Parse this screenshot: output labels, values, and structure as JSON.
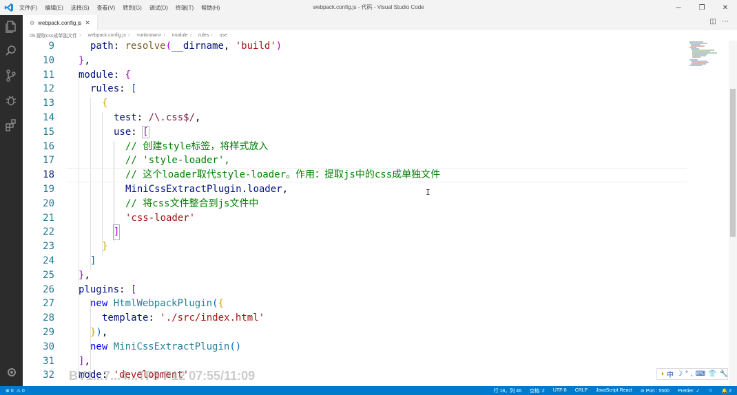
{
  "window": {
    "title": "webpack.config.js - 代码 - Visual Studio Code",
    "menus": [
      "文件(F)",
      "编辑(E)",
      "选择(S)",
      "查看(V)",
      "转到(G)",
      "调试(D)",
      "终端(T)",
      "帮助(H)"
    ],
    "controls": [
      "─",
      "❐",
      "✕"
    ]
  },
  "tabs": [
    {
      "label": "webpack.config.js",
      "icon": "config-file-icon",
      "close": "✕"
    }
  ],
  "tab_actions": [
    "◫",
    "⋯"
  ],
  "breadcrumb": [
    "09.提取css成单独文件",
    "webpack.config.js",
    "<unknown>",
    "module",
    "rules",
    "use"
  ],
  "editor": {
    "line_numbers": [
      "9",
      "10",
      "11",
      "12",
      "13",
      "14",
      "15",
      "16",
      "17",
      "18",
      "19",
      "20",
      "21",
      "22",
      "23",
      "24",
      "25",
      "26",
      "27",
      "28",
      "29",
      "30",
      "31",
      "32"
    ],
    "current_line": "18"
  },
  "code": {
    "l9": [
      "path",
      ": ",
      "resolve",
      "(",
      "__dirname",
      ", ",
      "'build'",
      ")"
    ],
    "l10": [
      "}",
      ","
    ],
    "l11": [
      "module",
      ": ",
      "{"
    ],
    "l12": [
      "rules",
      ": ",
      "["
    ],
    "l13": [
      "{"
    ],
    "l14": [
      "test",
      ": ",
      "/\\.css$/",
      ","
    ],
    "l15": [
      "use",
      ": ",
      "["
    ],
    "l16": "// 创建style标签，将样式放入",
    "l17": "// 'style-loader',",
    "l18": "// 这个loader取代style-loader。作用：提取js中的css成单独文件",
    "l19": [
      "MiniCssExtractPlugin",
      ".",
      "loader",
      ","
    ],
    "l20": "// 将css文件整合到js文件中",
    "l21": "'css-loader'",
    "l22": "]",
    "l23": "}",
    "l24": "]",
    "l25": [
      "}",
      ","
    ],
    "l26": [
      "plugins",
      ": ",
      "["
    ],
    "l27": [
      "new",
      " ",
      "HtmlWebpackPlugin",
      "(",
      "{"
    ],
    "l28": [
      "template",
      ": ",
      "'./src/index.html'"
    ],
    "l29": [
      "}",
      ")",
      ","
    ],
    "l30": [
      "new",
      " ",
      "MiniCssExtractPlugin",
      "()"
    ],
    "l31": [
      "]",
      ","
    ],
    "l32": [
      "mode",
      ": ",
      "'development'"
    ]
  },
  "statusbar": {
    "left": [
      "⊗ 0",
      "⚠ 0"
    ],
    "right": [
      "行 18，列 46",
      "空格: 2",
      "UTF-8",
      "CRLF",
      "JavaScript React",
      "⊘ Port : 5500",
      "Prettier: ✓",
      "☺",
      "🔔 2"
    ]
  },
  "ime": [
    "中",
    "☽",
    "°",
    ",",
    "⌨",
    "👕",
    "🔧"
  ],
  "watermark": "BV1...7...4...TF5 P12 07:55/11:09",
  "colors": {
    "activity_bar": "#2c2c2c",
    "status_bar": "#007acc",
    "line_number": "#237893",
    "keyword": "#0000ff",
    "string": "#a31515",
    "comment": "#008000"
  }
}
